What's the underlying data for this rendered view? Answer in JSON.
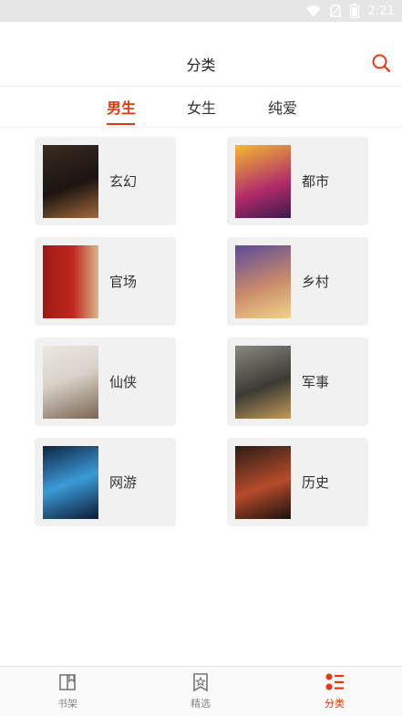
{
  "status_bar": {
    "time": "2:21"
  },
  "header": {
    "title": "分类"
  },
  "tabs": [
    {
      "label": "男生",
      "active": true
    },
    {
      "label": "女生",
      "active": false
    },
    {
      "label": "纯爱",
      "active": false
    }
  ],
  "categories": [
    {
      "label": "玄幻",
      "cover_colors": [
        "#3a2c22",
        "#a36a3b"
      ]
    },
    {
      "label": "都市",
      "cover_colors": [
        "#b02a6a",
        "#f3b933"
      ]
    },
    {
      "label": "官场",
      "cover_colors": [
        "#9e1a15",
        "#d8b98a"
      ]
    },
    {
      "label": "乡村",
      "cover_colors": [
        "#5a4a9a",
        "#f1d38a"
      ]
    },
    {
      "label": "仙侠",
      "cover_colors": [
        "#d9d2c8",
        "#7a6553"
      ]
    },
    {
      "label": "军事",
      "cover_colors": [
        "#3b3a34",
        "#c29a58"
      ]
    },
    {
      "label": "网游",
      "cover_colors": [
        "#0e2443",
        "#3b9bd7"
      ]
    },
    {
      "label": "历史",
      "cover_colors": [
        "#2a1d16",
        "#b74b2a"
      ]
    }
  ],
  "bottom_nav": [
    {
      "label": "书架",
      "icon": "bookshelf-icon",
      "active": false
    },
    {
      "label": "精选",
      "icon": "featured-icon",
      "active": false
    },
    {
      "label": "分类",
      "icon": "category-icon",
      "active": true
    }
  ],
  "colors": {
    "accent": "#e4390e",
    "card_bg": "#f1f1f1"
  }
}
